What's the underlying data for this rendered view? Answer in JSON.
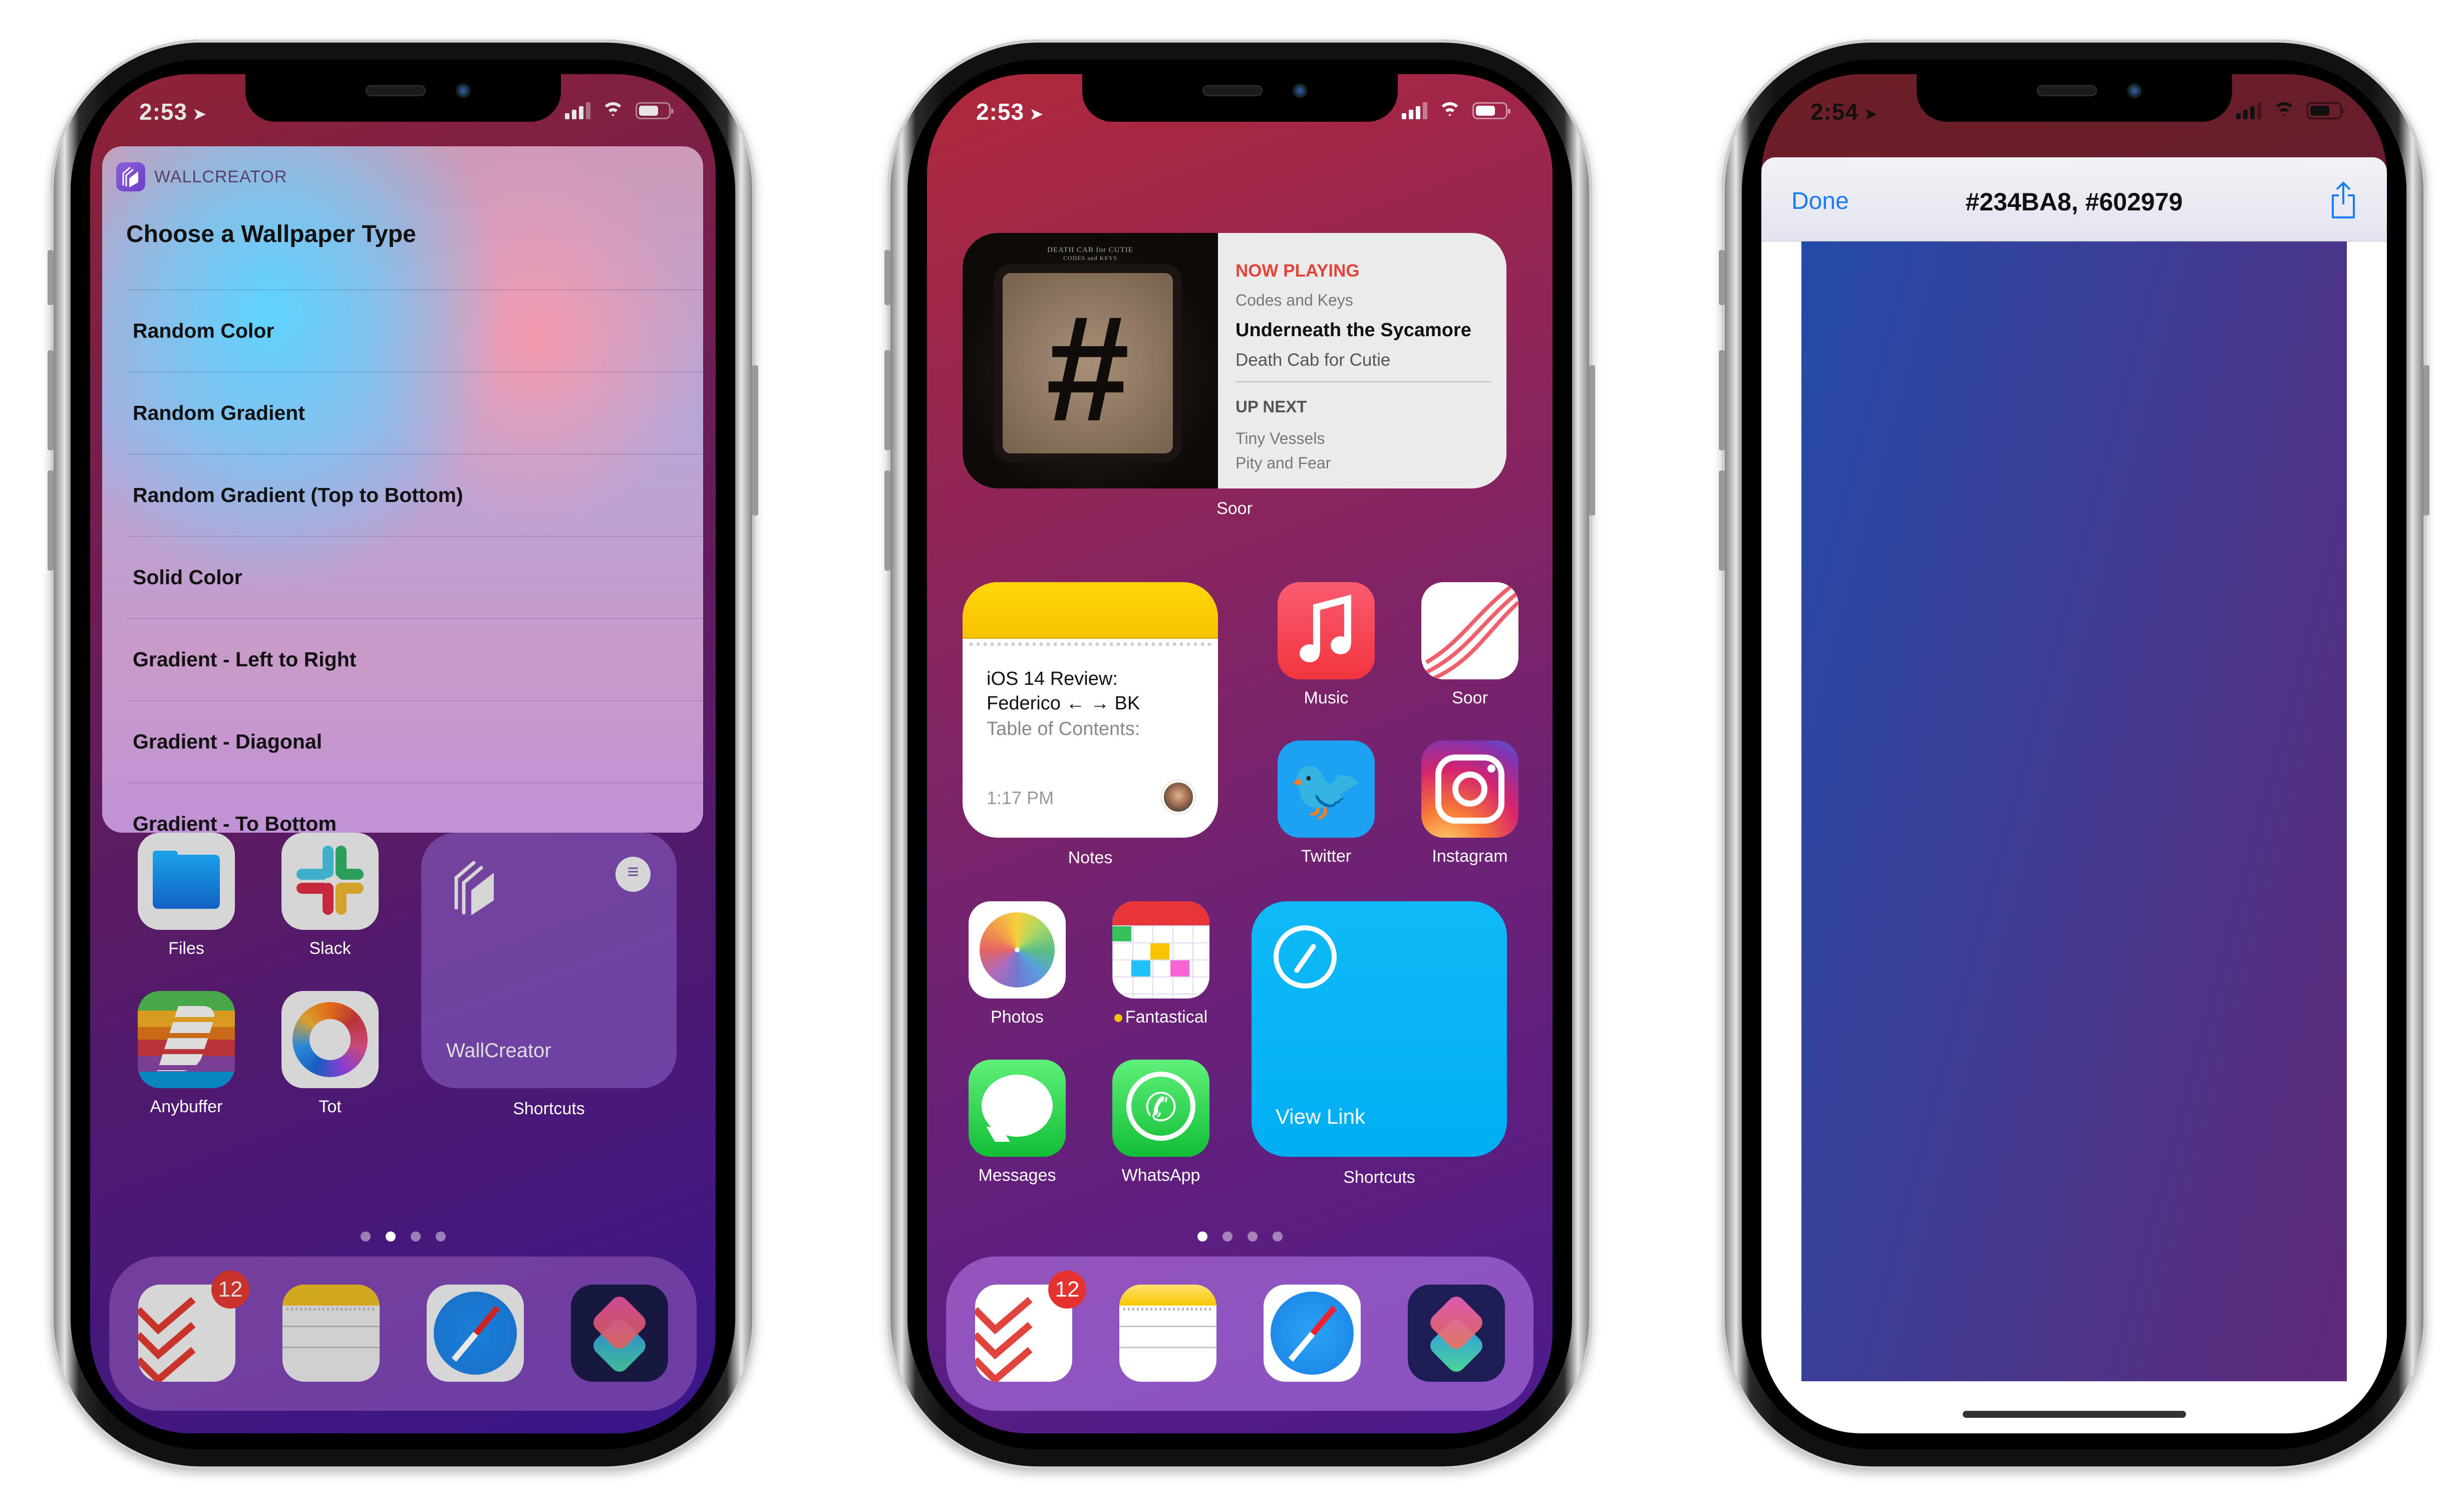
{
  "phones": [
    {
      "status": {
        "time": "2:53",
        "location_icon": "location-arrow-icon"
      },
      "menu": {
        "app_name": "WALLCREATOR",
        "title": "Choose a Wallpaper Type",
        "items": [
          "Random Color",
          "Random Gradient",
          "Random Gradient (Top to Bottom)",
          "Solid Color",
          "Gradient - Left to Right",
          "Gradient - Diagonal",
          "Gradient - To Bottom"
        ]
      },
      "apps": [
        {
          "label": "Files",
          "icon": "files-icon"
        },
        {
          "label": "Slack",
          "icon": "slack-icon"
        },
        {
          "label": "Anybuffer",
          "icon": "anybuffer-icon"
        },
        {
          "label": "Tot",
          "icon": "tot-icon"
        }
      ],
      "shortcut_widget": {
        "name": "WallCreator",
        "label": "Shortcuts"
      },
      "page_dots": {
        "count": 4,
        "active": 2
      },
      "dock": [
        {
          "app": "Todoist",
          "icon": "todoist-icon",
          "badge": "12"
        },
        {
          "app": "Notes",
          "icon": "notes-icon"
        },
        {
          "app": "Safari",
          "icon": "safari-icon"
        },
        {
          "app": "Shortcuts",
          "icon": "shortcuts-icon"
        }
      ]
    },
    {
      "status": {
        "time": "2:53",
        "location_icon": "location-arrow-icon"
      },
      "music_widget": {
        "art_text_line1": "DEATH CAB for CUTIE",
        "art_text_line2": "CODES and KEYS",
        "now_playing": "NOW PLAYING",
        "album": "Codes and Keys",
        "song": "Underneath the Sycamore",
        "artist": "Death Cab for Cutie",
        "up_next": "UP NEXT",
        "queue": [
          "Tiny Vessels",
          "Pity and Fear"
        ],
        "label": "Soor"
      },
      "notes_widget": {
        "title_line1": "iOS 14 Review:",
        "title_line2": "Federico ← → BK",
        "subtitle": "Table of Contents:",
        "time": "1:17 PM",
        "label": "Notes"
      },
      "apps": [
        {
          "label": "Music",
          "icon": "music-icon"
        },
        {
          "label": "Soor",
          "icon": "soor-icon"
        },
        {
          "label": "Twitter",
          "icon": "twitter-icon"
        },
        {
          "label": "Instagram",
          "icon": "instagram-icon"
        },
        {
          "label": "Photos",
          "icon": "photos-icon"
        },
        {
          "label": "Fantastical",
          "icon": "fantastical-icon",
          "dot": true
        },
        {
          "label": "Messages",
          "icon": "messages-icon"
        },
        {
          "label": "WhatsApp",
          "icon": "whatsapp-icon"
        }
      ],
      "shortcut_widget": {
        "name": "View Link",
        "label": "Shortcuts"
      },
      "page_dots": {
        "count": 4,
        "active": 1
      },
      "dock": [
        {
          "app": "Todoist",
          "icon": "todoist-icon",
          "badge": "12"
        },
        {
          "app": "Notes",
          "icon": "notes-icon"
        },
        {
          "app": "Safari",
          "icon": "safari-icon"
        },
        {
          "app": "Shortcuts",
          "icon": "shortcuts-icon"
        }
      ]
    },
    {
      "status": {
        "time": "2:54",
        "location_icon": "location-arrow-icon"
      },
      "preview": {
        "done_label": "Done",
        "title": "#234BA8, #602979",
        "gradient_from": "#234BA8",
        "gradient_to": "#602979"
      }
    }
  ],
  "colors": {
    "ios_blue": "#1A7CF5",
    "badge_red": "#E5322F",
    "now_playing_red": "#E5433A"
  }
}
